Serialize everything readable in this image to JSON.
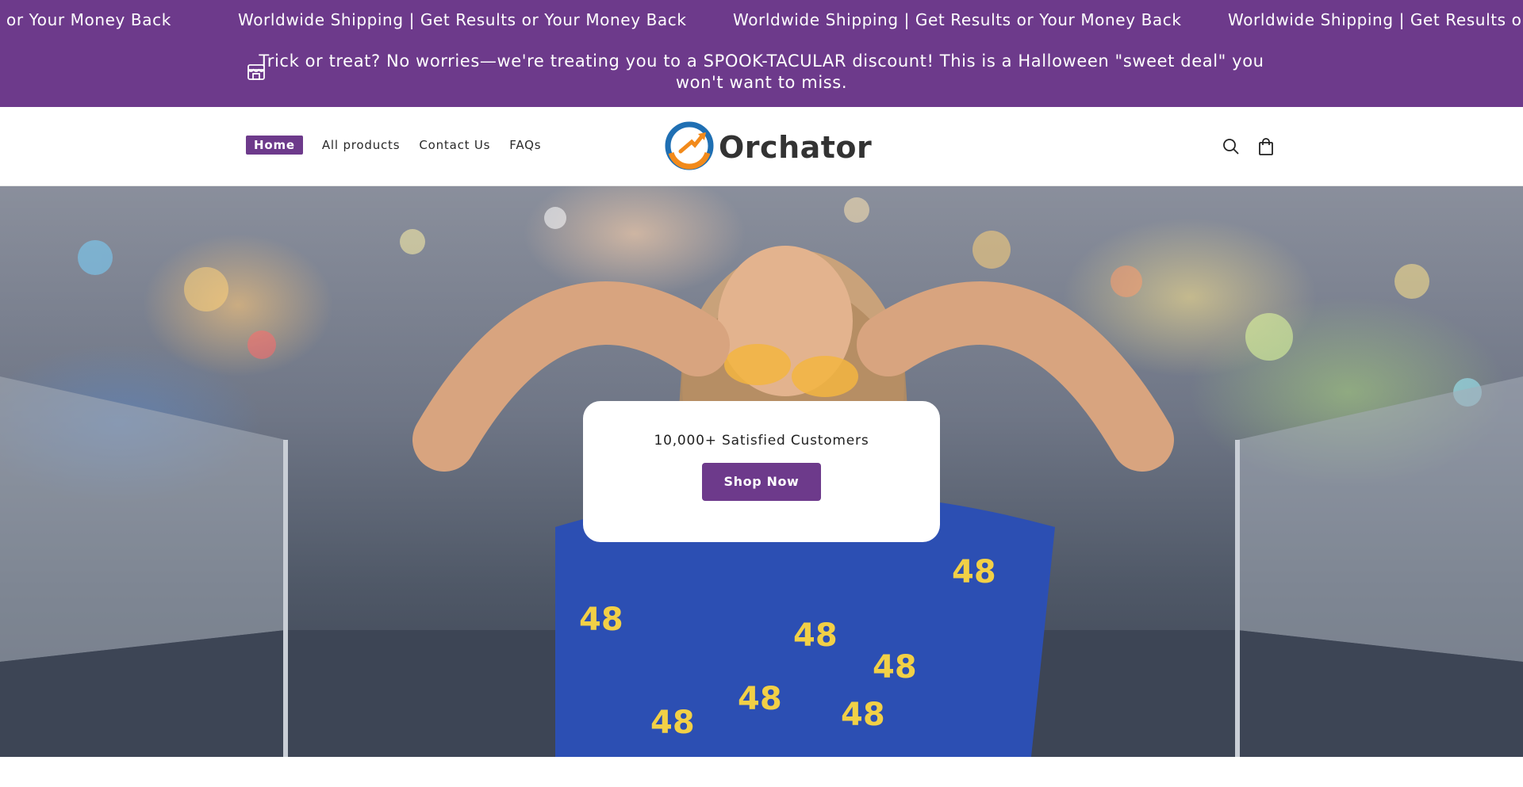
{
  "marquee": {
    "items": [
      "or Your Money Back",
      "Worldwide Shipping | Get Results or Your Money Back",
      "Worldwide Shipping | Get Results or Your Money Back",
      "Worldwide Shipping | Get Results or Yo"
    ]
  },
  "announcement": {
    "icon": "store-icon",
    "text": "Trick or treat?   No worries—we're treating you to a SPOOK-TACULAR discount!   This is a Halloween \"sweet deal\" you won't want to miss."
  },
  "header": {
    "nav": [
      {
        "label": "Home",
        "active": true
      },
      {
        "label": "All products",
        "active": false
      },
      {
        "label": "Contact Us",
        "active": false
      },
      {
        "label": "FAQs",
        "active": false
      }
    ],
    "logo_text": "Orchator",
    "icons": [
      "search-icon",
      "cart-icon"
    ]
  },
  "hero": {
    "tagline": "10,000+ Satisfied Customers",
    "cta_label": "Shop Now"
  },
  "colors": {
    "brand_purple": "#6d3a8b",
    "logo_blue": "#1f6fb3",
    "logo_orange": "#f28a1b"
  }
}
